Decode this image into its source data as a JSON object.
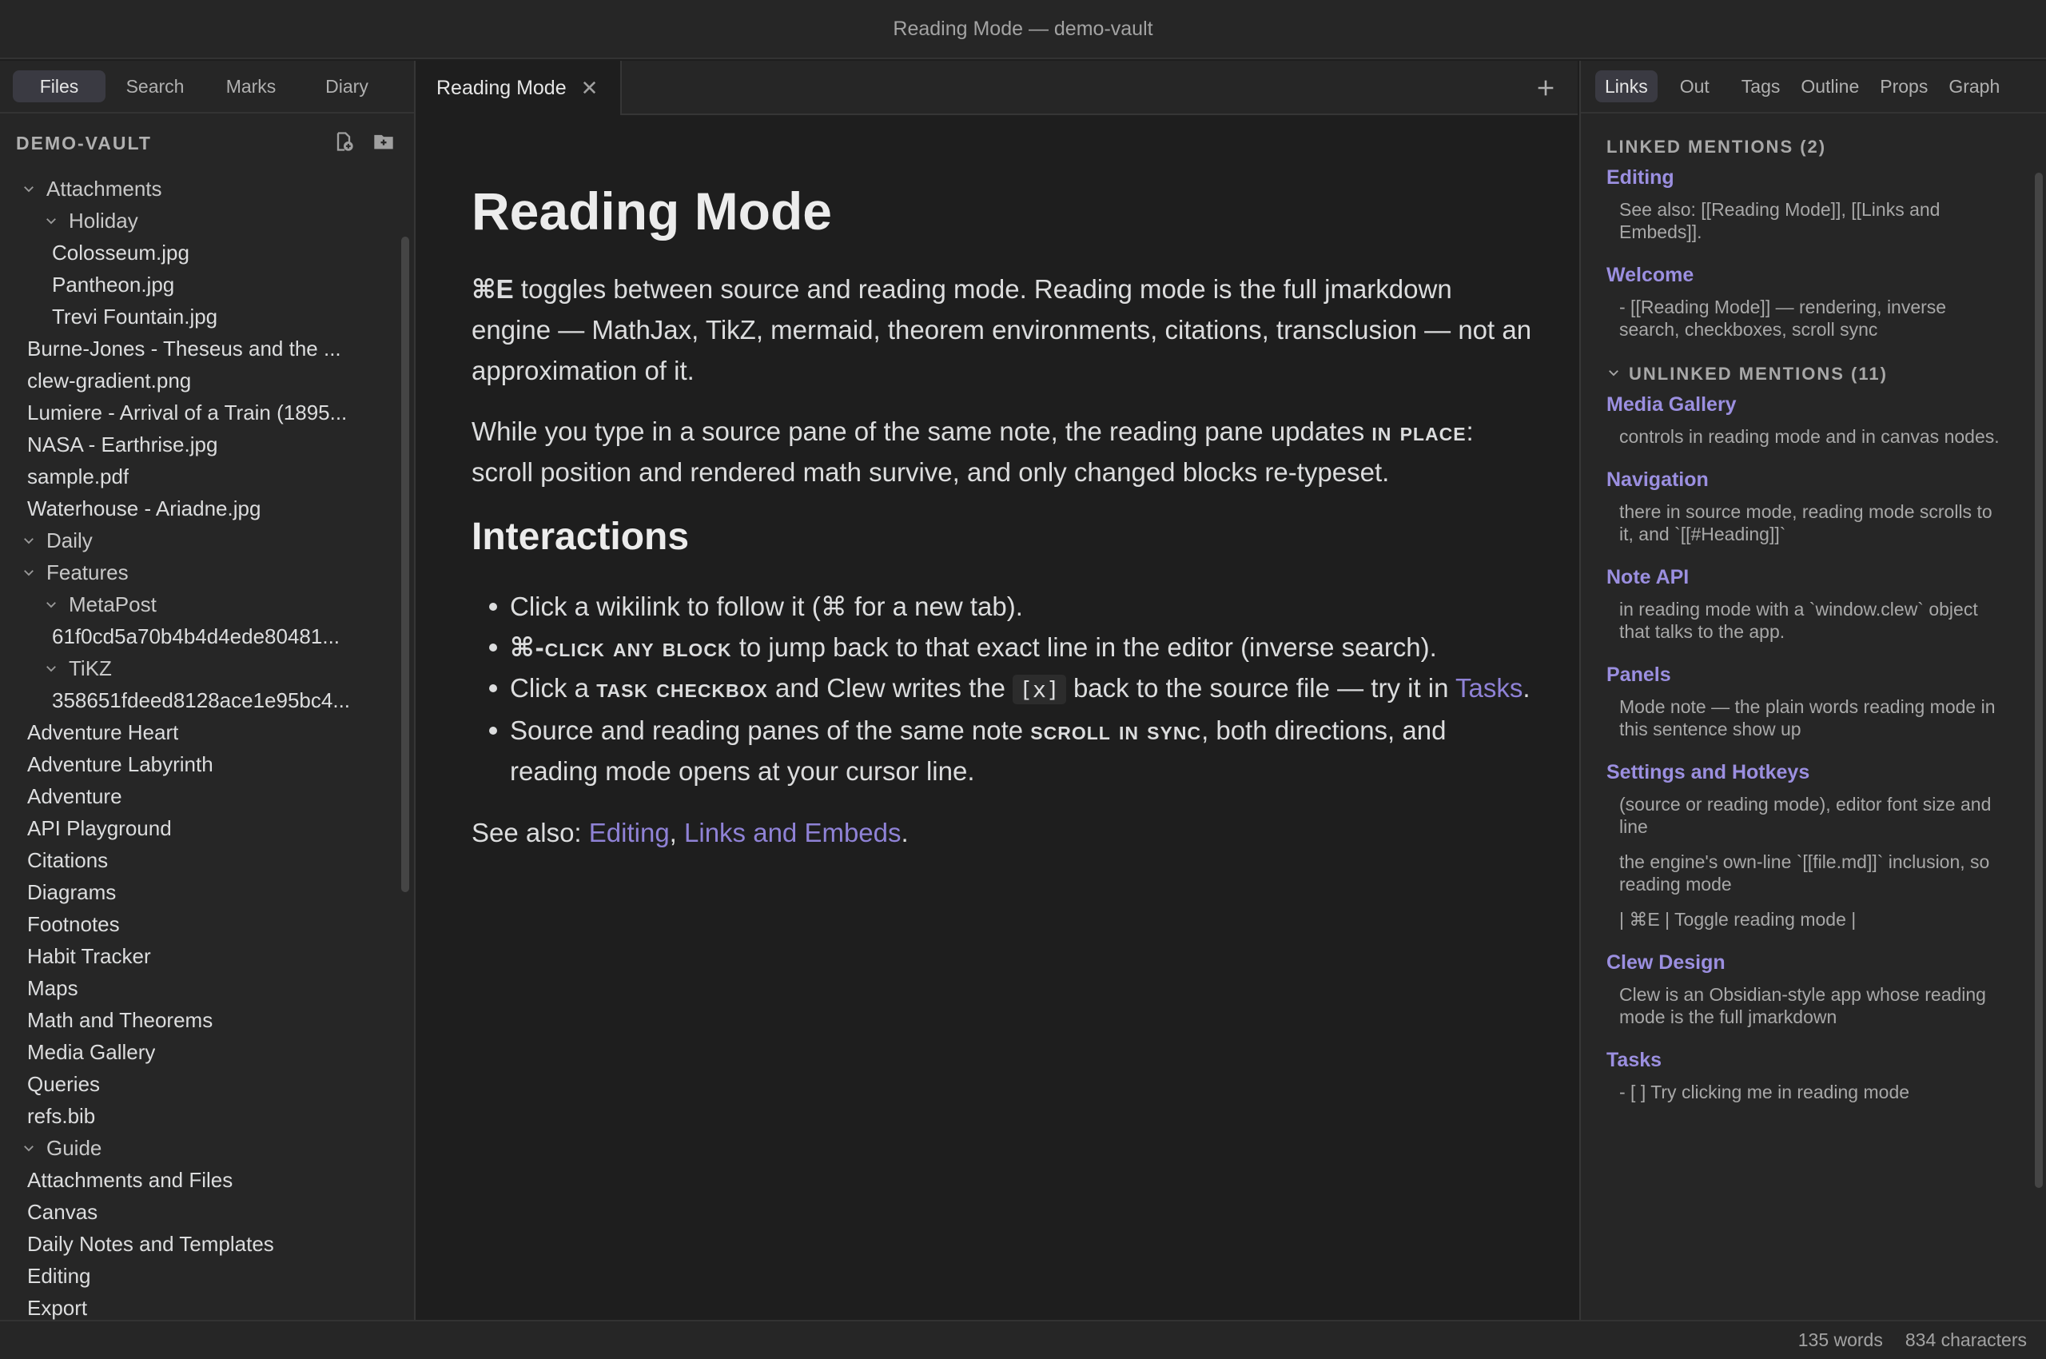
{
  "window": {
    "title": "Reading Mode — demo-vault"
  },
  "left_sidebar": {
    "tabs": [
      "Files",
      "Search",
      "Marks",
      "Diary"
    ],
    "vault_name": "DEMO-VAULT",
    "tree": [
      {
        "label": "Attachments",
        "depth": 0,
        "folder": true
      },
      {
        "label": "Holiday",
        "depth": 1,
        "folder": true
      },
      {
        "label": "Colosseum.jpg",
        "depth": 2,
        "folder": false
      },
      {
        "label": "Pantheon.jpg",
        "depth": 2,
        "folder": false
      },
      {
        "label": "Trevi Fountain.jpg",
        "depth": 2,
        "folder": false
      },
      {
        "label": "Burne-Jones - Theseus and the ...",
        "depth": 1,
        "folder": false
      },
      {
        "label": "clew-gradient.png",
        "depth": 1,
        "folder": false
      },
      {
        "label": "Lumiere - Arrival of a Train (1895...",
        "depth": 1,
        "folder": false
      },
      {
        "label": "NASA - Earthrise.jpg",
        "depth": 1,
        "folder": false
      },
      {
        "label": "sample.pdf",
        "depth": 1,
        "folder": false
      },
      {
        "label": "Waterhouse - Ariadne.jpg",
        "depth": 1,
        "folder": false
      },
      {
        "label": "Daily",
        "depth": 0,
        "folder": true
      },
      {
        "label": "Features",
        "depth": 0,
        "folder": true
      },
      {
        "label": "MetaPost",
        "depth": 1,
        "folder": true
      },
      {
        "label": "61f0cd5a70b4b4d4ede80481...",
        "depth": 2,
        "folder": false
      },
      {
        "label": "TiKZ",
        "depth": 1,
        "folder": true
      },
      {
        "label": "358651fdeed8128ace1e95bc4...",
        "depth": 2,
        "folder": false
      },
      {
        "label": "Adventure Heart",
        "depth": 1,
        "folder": false
      },
      {
        "label": "Adventure Labyrinth",
        "depth": 1,
        "folder": false
      },
      {
        "label": "Adventure",
        "depth": 1,
        "folder": false
      },
      {
        "label": "API Playground",
        "depth": 1,
        "folder": false
      },
      {
        "label": "Citations",
        "depth": 1,
        "folder": false
      },
      {
        "label": "Diagrams",
        "depth": 1,
        "folder": false
      },
      {
        "label": "Footnotes",
        "depth": 1,
        "folder": false
      },
      {
        "label": "Habit Tracker",
        "depth": 1,
        "folder": false
      },
      {
        "label": "Maps",
        "depth": 1,
        "folder": false
      },
      {
        "label": "Math and Theorems",
        "depth": 1,
        "folder": false
      },
      {
        "label": "Media Gallery",
        "depth": 1,
        "folder": false
      },
      {
        "label": "Queries",
        "depth": 1,
        "folder": false
      },
      {
        "label": "refs.bib",
        "depth": 1,
        "folder": false
      },
      {
        "label": "Guide",
        "depth": 0,
        "folder": true
      },
      {
        "label": "Attachments and Files",
        "depth": 1,
        "folder": false
      },
      {
        "label": "Canvas",
        "depth": 1,
        "folder": false
      },
      {
        "label": "Daily Notes and Templates",
        "depth": 1,
        "folder": false
      },
      {
        "label": "Editing",
        "depth": 1,
        "folder": false
      },
      {
        "label": "Export",
        "depth": 1,
        "folder": false
      }
    ]
  },
  "editor": {
    "tab_title": "Reading Mode",
    "doc": {
      "title": "Reading Mode",
      "p1_key": "⌘E",
      "p1_text": " toggles between source and reading mode. Reading mode is the full jmarkdown engine — MathJax, TikZ, mermaid, theorem environments, citations, transclusion — not an approximation of it.",
      "p2_a": "While you type in a source pane of the same note, the reading pane updates ",
      "p2_sc": "in place",
      "p2_b": ": scroll position and rendered math survive, and only changed blocks re-typeset.",
      "h2": "Interactions",
      "b1": "Click a wikilink to follow it (⌘ for a new tab).",
      "b2_sc": "⌘-click any block",
      "b2_text": " to jump back to that exact line in the editor (inverse search).",
      "b3_a": "Click a ",
      "b3_sc": "task checkbox",
      "b3_b": " and Clew writes the ",
      "b3_code": "[x]",
      "b3_c": " back to the source file — try it in ",
      "b3_link": "Tasks",
      "b3_end": ".",
      "b4_a": "Source and reading panes of the same note ",
      "b4_sc": "scroll in sync",
      "b4_b": ", both directions, and reading mode opens at your cursor line.",
      "see_also_label": "See also: ",
      "see_also_link1": "Editing",
      "see_also_sep": ", ",
      "see_also_link2": "Links and Embeds",
      "see_also_end": "."
    }
  },
  "right_sidebar": {
    "tabs": [
      "Links",
      "Out",
      "Tags",
      "Outline",
      "Props",
      "Graph"
    ],
    "linked_header": "LINKED MENTIONS (2)",
    "linked": [
      {
        "title": "Editing",
        "snippets": [
          "See also: [[Reading Mode]], [[Links and Embeds]]."
        ]
      },
      {
        "title": "Welcome",
        "snippets": [
          "- [[Reading Mode]] — rendering, inverse search, checkboxes, scroll sync"
        ]
      }
    ],
    "unlinked_header": "UNLINKED MENTIONS (11)",
    "unlinked": [
      {
        "title": "Media Gallery",
        "snippets": [
          "controls in reading mode and in canvas nodes."
        ]
      },
      {
        "title": "Navigation",
        "snippets": [
          "there in source mode, reading mode scrolls to it, and `[[#Heading]]`"
        ]
      },
      {
        "title": "Note API",
        "snippets": [
          "in reading mode with a `window.clew` object that talks to the app."
        ]
      },
      {
        "title": "Panels",
        "snippets": [
          "Mode note — the plain words reading mode in this sentence show up"
        ]
      },
      {
        "title": "Settings and Hotkeys",
        "snippets": [
          "(source or reading mode), editor font size and line",
          "the engine's own-line `[[file.md]]` inclusion, so reading mode",
          "| ⌘E | Toggle reading mode |"
        ]
      },
      {
        "title": "Clew Design",
        "snippets": [
          "Clew is an Obsidian-style app whose reading mode is the full jmarkdown"
        ]
      },
      {
        "title": "Tasks",
        "snippets": [
          "- [ ] Try clicking me in reading mode"
        ]
      }
    ]
  },
  "status_bar": {
    "words": "135 words",
    "characters": "834 characters"
  },
  "colors": {
    "accent": "#9b8fe0",
    "link": "#8f82d6",
    "background": "#1e1e1e",
    "panel": "#262626"
  }
}
